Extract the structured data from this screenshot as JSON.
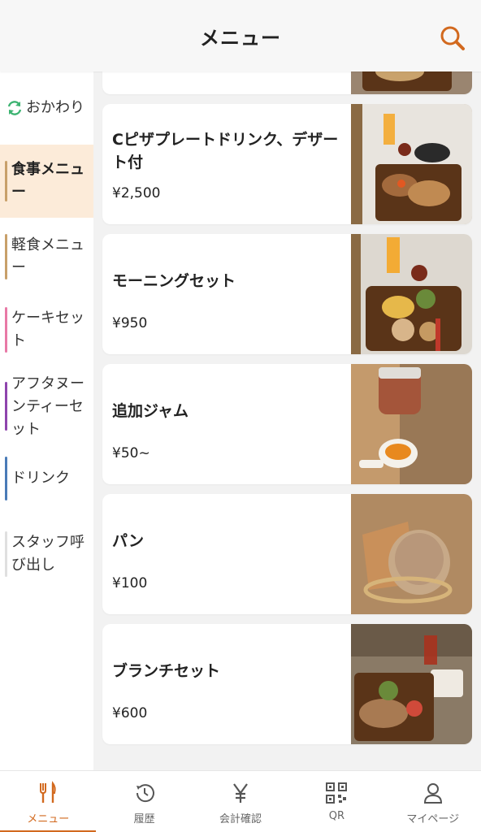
{
  "header": {
    "title": "メニュー",
    "search_icon": "search-icon"
  },
  "sidebar": {
    "refill_label": "おかわり",
    "items": [
      {
        "label": "食事メニュー",
        "color": "#c8a06a",
        "active": true
      },
      {
        "label": "軽食メニュー",
        "color": "#c8a06a",
        "active": false
      },
      {
        "label": "ケーキセット",
        "color": "#e879a6",
        "active": false
      },
      {
        "label": "アフタヌーンティーセット",
        "color": "#8e44ad",
        "active": false
      },
      {
        "label": "ドリンク",
        "color": "#4a7bb7",
        "active": false
      },
      {
        "label": "スタッフ呼び出し",
        "color": "#e0e0e0",
        "active": false
      }
    ]
  },
  "menu_items": [
    {
      "name": "Cピザプレートドリンク、デザート付",
      "price": "¥2,500"
    },
    {
      "name": "モーニングセット",
      "price": "¥950"
    },
    {
      "name": "追加ジャム",
      "price": "¥50~"
    },
    {
      "name": "パン",
      "price": "¥100"
    },
    {
      "name": "ブランチセット",
      "price": "¥600"
    }
  ],
  "bottom_nav": [
    {
      "label": "メニュー",
      "icon": "fork-knife-icon",
      "active": true
    },
    {
      "label": "履歴",
      "icon": "history-icon",
      "active": false
    },
    {
      "label": "会計確認",
      "icon": "yen-icon",
      "active": false
    },
    {
      "label": "QR",
      "icon": "qr-code-icon",
      "active": false
    },
    {
      "label": "マイページ",
      "icon": "user-icon",
      "active": false
    }
  ],
  "colors": {
    "accent": "#d2691e",
    "active_bg": "#fcebd9",
    "content_bg": "#f2f2f2",
    "refill_green": "#3cb371"
  }
}
